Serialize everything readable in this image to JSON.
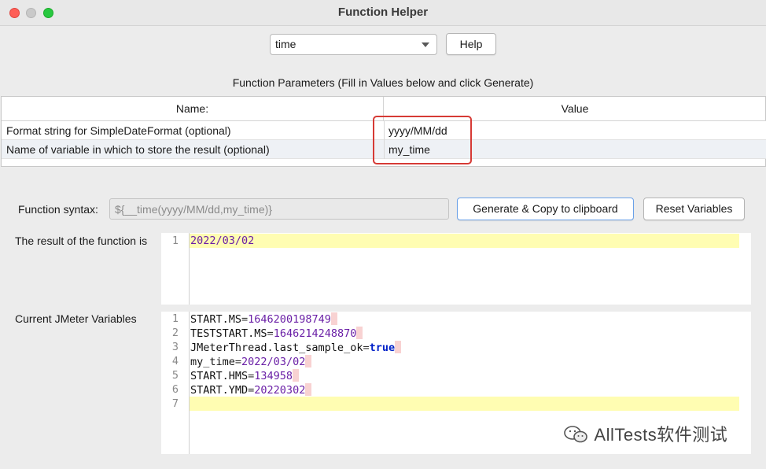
{
  "window": {
    "title": "Function Helper"
  },
  "function_select": {
    "selected": "time"
  },
  "help_button": {
    "label": "Help"
  },
  "params": {
    "caption": "Function Parameters (Fill in Values below and click Generate)",
    "headers": {
      "name": "Name:",
      "value": "Value"
    },
    "rows": [
      {
        "name": "Format string for SimpleDateFormat (optional)",
        "value": "yyyy/MM/dd"
      },
      {
        "name": "Name of variable in which to store the result (optional)",
        "value": "my_time"
      }
    ]
  },
  "syntax": {
    "label": "Function syntax:",
    "value": "${__time(yyyy/MM/dd,my_time)}",
    "generate_label": "Generate & Copy to clipboard",
    "reset_label": "Reset Variables"
  },
  "result": {
    "label": "The result of the function is",
    "lines": [
      "2022/03/02"
    ]
  },
  "variables": {
    "label": "Current JMeter Variables",
    "lines": [
      {
        "n": "1",
        "key": "START.MS",
        "val": "1646200198749"
      },
      {
        "n": "2",
        "key": "TESTSTART.MS",
        "val": "1646214248870"
      },
      {
        "n": "3",
        "key": "JMeterThread.last_sample_ok",
        "val": "true"
      },
      {
        "n": "4",
        "key": "my_time",
        "val": "2022/03/02"
      },
      {
        "n": "5",
        "key": "START.HMS",
        "val": "134958"
      },
      {
        "n": "6",
        "key": "START.YMD",
        "val": "20220302"
      },
      {
        "n": "7",
        "key": "",
        "val": ""
      }
    ]
  },
  "watermark": {
    "text": "AllTests软件测试"
  },
  "colors": {
    "highlight_box": "#d63a35",
    "current_line": "#fffdb2",
    "number": "#6a1fa6",
    "keyword": "#0020c8"
  }
}
